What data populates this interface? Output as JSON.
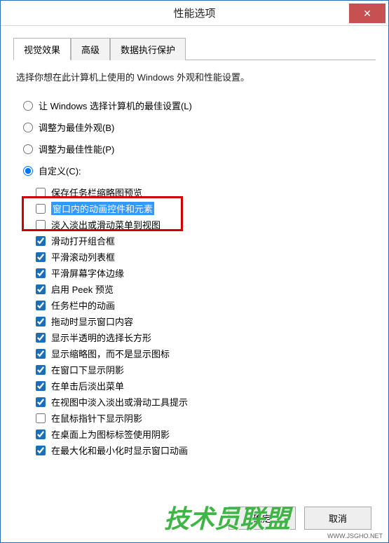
{
  "window": {
    "title": "性能选项"
  },
  "tabs": {
    "items": [
      {
        "label": "视觉效果",
        "active": true
      },
      {
        "label": "高级",
        "active": false
      },
      {
        "label": "数据执行保护",
        "active": false
      }
    ]
  },
  "description": "选择你想在此计算机上使用的 Windows 外观和性能设置。",
  "radio_options": [
    {
      "label": "让 Windows 选择计算机的最佳设置(L)",
      "checked": false
    },
    {
      "label": "调整为最佳外观(B)",
      "checked": false
    },
    {
      "label": "调整为最佳性能(P)",
      "checked": false
    },
    {
      "label": "自定义(C):",
      "checked": true
    }
  ],
  "checkboxes": [
    {
      "label": "保存任务栏缩略图预览",
      "checked": false,
      "highlighted": false
    },
    {
      "label": "窗口内的动画控件和元素",
      "checked": false,
      "highlighted": true
    },
    {
      "label": "淡入淡出或滑动菜单到视图",
      "checked": false,
      "highlighted": false
    },
    {
      "label": "滑动打开组合框",
      "checked": true,
      "highlighted": false
    },
    {
      "label": "平滑滚动列表框",
      "checked": true,
      "highlighted": false
    },
    {
      "label": "平滑屏幕字体边缘",
      "checked": true,
      "highlighted": false
    },
    {
      "label": "启用 Peek 预览",
      "checked": true,
      "highlighted": false
    },
    {
      "label": "任务栏中的动画",
      "checked": true,
      "highlighted": false
    },
    {
      "label": "拖动时显示窗口内容",
      "checked": true,
      "highlighted": false
    },
    {
      "label": "显示半透明的选择长方形",
      "checked": true,
      "highlighted": false
    },
    {
      "label": "显示缩略图，而不是显示图标",
      "checked": true,
      "highlighted": false
    },
    {
      "label": "在窗口下显示阴影",
      "checked": true,
      "highlighted": false
    },
    {
      "label": "在单击后淡出菜单",
      "checked": true,
      "highlighted": false
    },
    {
      "label": "在视图中淡入淡出或滑动工具提示",
      "checked": true,
      "highlighted": false
    },
    {
      "label": "在鼠标指针下显示阴影",
      "checked": false,
      "highlighted": false
    },
    {
      "label": "在桌面上为图标标签使用阴影",
      "checked": true,
      "highlighted": false
    },
    {
      "label": "在最大化和最小化时显示窗口动画",
      "checked": true,
      "highlighted": false
    }
  ],
  "buttons": {
    "ok": "确定",
    "cancel": "取消"
  },
  "watermark": {
    "text": "技术员联盟",
    "url": "WWW.JSGHO.NET"
  }
}
